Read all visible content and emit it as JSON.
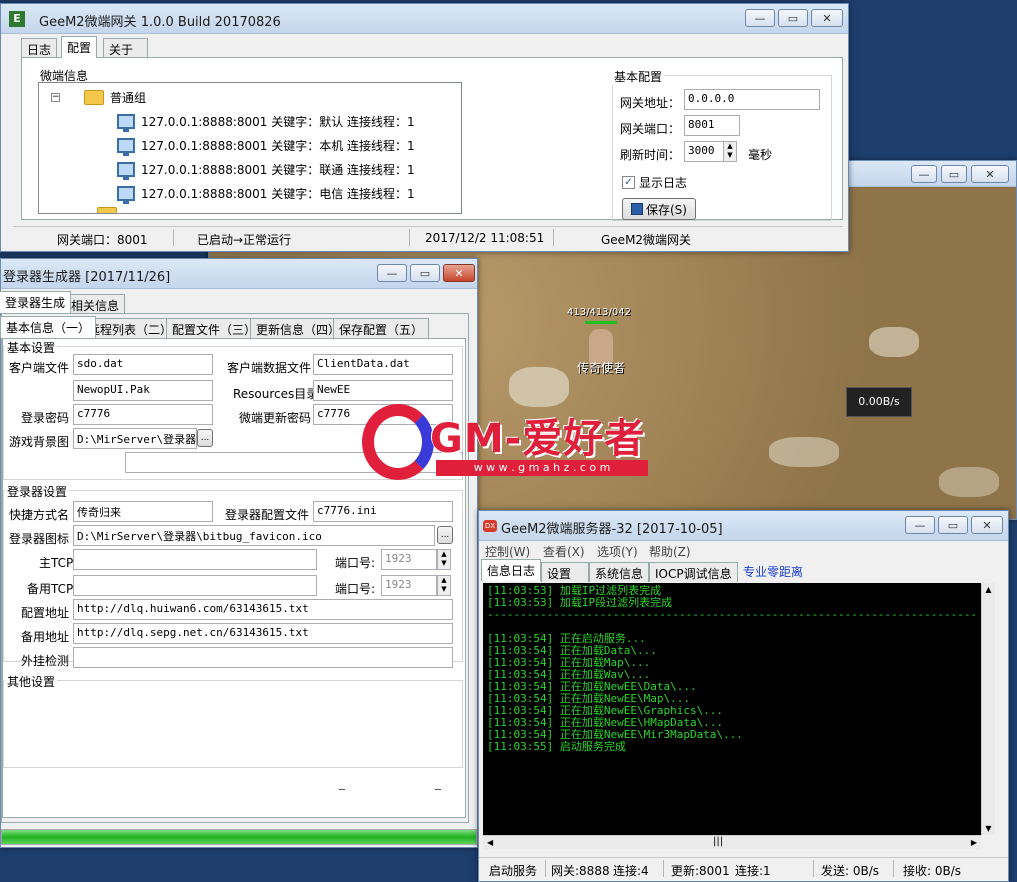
{
  "gateway": {
    "title": "GeeM2微端网关 1.0.0 Build 20170826",
    "tabs": [
      "日志",
      "配置",
      "关于"
    ],
    "tree_title": "微端信息",
    "group_name": "普通组",
    "nodes": [
      "127.0.0.1:8888:8001 关键字：默认 连接线程：1",
      "127.0.0.1:8888:8001 关键字：本机 连接线程：1",
      "127.0.0.1:8888:8001 关键字：联通 连接线程：1",
      "127.0.0.1:8888:8001 关键字：电信 连接线程：1"
    ],
    "basic_title": "基本配置",
    "addr_label": "网关地址：",
    "addr_value": "0.0.0.0",
    "port_label": "网关端口：",
    "port_value": "8001",
    "refresh_label": "刷新时间：",
    "refresh_value": "3000",
    "refresh_unit": "毫秒",
    "showlog_label": "显示日志",
    "save_label": "保存(S)",
    "status": [
      "网关端口：8001",
      "已启动→正常运行",
      "2017/12/2 11:08:51",
      "GeeM2微端网关"
    ]
  },
  "game": {
    "player_hp": "413/413/042",
    "player_name": "传奇使者",
    "speed": "0.00B/s"
  },
  "logo": {
    "text": "GM-爱好者",
    "url": "w w w . g m a h z . c o m"
  },
  "generator": {
    "title": "登录器生成器 [2017/11/26]",
    "tabs": [
      "登录器生成",
      "相关信息"
    ],
    "subtabs": [
      "基本信息（一）",
      "远程列表（二）",
      "配置文件（三）",
      "更新信息（四）",
      "保存配置（五）"
    ],
    "basic_title": "基本设置",
    "client_file_label": "客户端文件",
    "client_file_value": "sdo.dat",
    "client_data_label": "客户端数据文件",
    "client_data_value": "ClientData.dat",
    "ui_value": "NewopUI.Pak",
    "resources_label": "Resources目录",
    "resources_value": "NewEE",
    "pwd_label": "登录密码",
    "pwd_value": "c7776",
    "update_pwd_label": "微端更新密码",
    "update_pwd_value": "c7776",
    "bg_label": "游戏背景图",
    "bg_value": "D:\\MirServer\\登录器\\",
    "browse_label": "...",
    "launcher_title": "登录器设置",
    "shortcut_label": "快捷方式名",
    "shortcut_value": "传奇归来",
    "config_file_label": "登录器配置文件",
    "config_file_value": "c7776.ini",
    "icon_label": "登录器图标",
    "icon_value": "D:\\MirServer\\登录器\\bitbug_favicon.ico",
    "main_tcp_label": "主TCP",
    "main_port_label": "端口号:",
    "main_port_value": "1923",
    "backup_tcp_label": "备用TCP",
    "backup_port_label": "端口号:",
    "backup_port_value": "1923",
    "config_addr_label": "配置地址",
    "config_addr_value": "http://dlq.huiwan6.com/63143615.txt",
    "backup_addr_label": "备用地址",
    "backup_addr_value": "http://dlq.sepg.net.cn/63143615.txt",
    "plugin_label": "外挂检测",
    "other_title": "其他设置",
    "progress": 1.0
  },
  "server": {
    "title": "GeeM2微端服务器-32 [2017-10-05]",
    "menus": [
      "控制(W)",
      "查看(X)",
      "选项(Y)",
      "帮助(Z)"
    ],
    "tabs": [
      "信息日志",
      "设置",
      "系统信息",
      "IOCP调试信息"
    ],
    "link": "专业零距离",
    "log": [
      "[11:03:53] 加载IP过滤列表完成",
      "[11:03:53] 加载IP段过滤列表完成",
      "------------------------------------------------------------------------------------------",
      "",
      "[11:03:54] 正在启动服务...",
      "[11:03:54] 正在加载Data\\...",
      "[11:03:54] 正在加载Map\\...",
      "[11:03:54] 正在加载Wav\\...",
      "[11:03:54] 正在加载NewEE\\Data\\...",
      "[11:03:54] 正在加载NewEE\\Map\\...",
      "[11:03:54] 正在加载NewEE\\Graphics\\...",
      "[11:03:54] 正在加载NewEE\\HMapData\\...",
      "[11:03:54] 正在加载NewEE\\Mir3MapData\\...",
      "[11:03:55] 启动服务完成"
    ],
    "status": [
      "启动服务",
      "网关:8888",
      "连接:4",
      "更新:8001",
      "连接:1",
      "发送: 0B/s",
      "接收: 0B/s"
    ]
  }
}
